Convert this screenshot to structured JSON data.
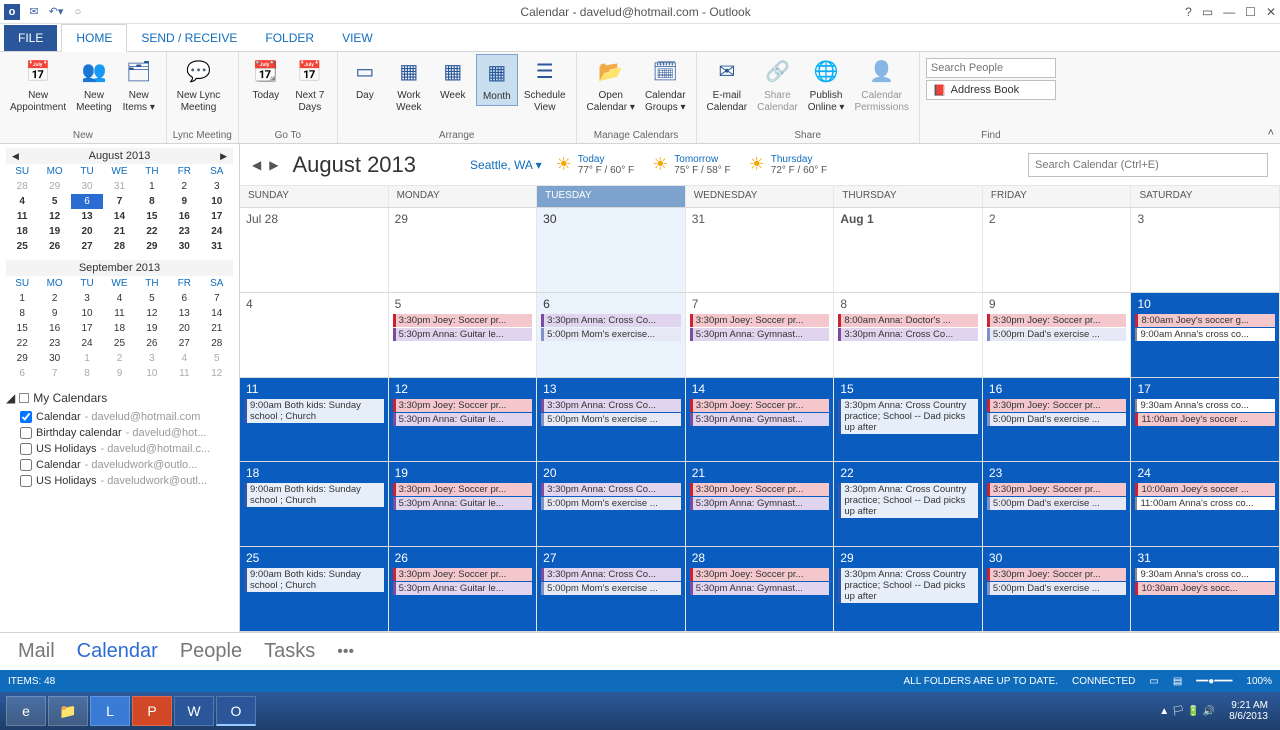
{
  "window": {
    "title": "Calendar - davelud@hotmail.com - Outlook"
  },
  "tabs": {
    "file": "FILE",
    "home": "HOME",
    "sendreceive": "SEND / RECEIVE",
    "folder": "FOLDER",
    "view": "VIEW"
  },
  "ribbon": {
    "new": {
      "label": "New",
      "appt": "New\nAppointment",
      "meeting": "New\nMeeting",
      "items": "New\nItems ▾"
    },
    "lync": {
      "label": "Lync Meeting",
      "btn": "New Lync\nMeeting"
    },
    "goto": {
      "label": "Go To",
      "today": "Today",
      "next7": "Next 7\nDays"
    },
    "arrange": {
      "label": "Arrange",
      "day": "Day",
      "workwk": "Work\nWeek",
      "week": "Week",
      "month": "Month",
      "sched": "Schedule\nView"
    },
    "manage": {
      "label": "Manage Calendars",
      "open": "Open\nCalendar ▾",
      "groups": "Calendar\nGroups ▾"
    },
    "share": {
      "label": "Share",
      "email": "E-mail\nCalendar",
      "share": "Share\nCalendar",
      "publish": "Publish\nOnline ▾",
      "perms": "Calendar\nPermissions"
    },
    "find": {
      "label": "Find",
      "search_placeholder": "Search People",
      "abook": "Address Book"
    }
  },
  "mini1": {
    "title": "August 2013",
    "dow": [
      "SU",
      "MO",
      "TU",
      "WE",
      "TH",
      "FR",
      "SA"
    ],
    "rows": [
      [
        "28",
        "29",
        "30",
        "31",
        "1",
        "2",
        "3"
      ],
      [
        "4",
        "5",
        "6",
        "7",
        "8",
        "9",
        "10"
      ],
      [
        "11",
        "12",
        "13",
        "14",
        "15",
        "16",
        "17"
      ],
      [
        "18",
        "19",
        "20",
        "21",
        "22",
        "23",
        "24"
      ],
      [
        "25",
        "26",
        "27",
        "28",
        "29",
        "30",
        "31"
      ]
    ]
  },
  "mini2": {
    "title": "September 2013",
    "dow": [
      "SU",
      "MO",
      "TU",
      "WE",
      "TH",
      "FR",
      "SA"
    ],
    "rows": [
      [
        "1",
        "2",
        "3",
        "4",
        "5",
        "6",
        "7"
      ],
      [
        "8",
        "9",
        "10",
        "11",
        "12",
        "13",
        "14"
      ],
      [
        "15",
        "16",
        "17",
        "18",
        "19",
        "20",
        "21"
      ],
      [
        "22",
        "23",
        "24",
        "25",
        "26",
        "27",
        "28"
      ],
      [
        "29",
        "30",
        "1",
        "2",
        "3",
        "4",
        "5"
      ],
      [
        "6",
        "7",
        "8",
        "9",
        "10",
        "11",
        "12"
      ]
    ]
  },
  "mycal": {
    "header": "My Calendars",
    "items": [
      {
        "checked": true,
        "name": "Calendar",
        "acct": "davelud@hotmail.com"
      },
      {
        "checked": false,
        "name": "Birthday calendar",
        "acct": "davelud@hot..."
      },
      {
        "checked": false,
        "name": "US Holidays",
        "acct": "davelud@hotmail.c..."
      },
      {
        "checked": false,
        "name": "Calendar",
        "acct": "daveludwork@outlo..."
      },
      {
        "checked": false,
        "name": "US Holidays",
        "acct": "daveludwork@outl..."
      }
    ]
  },
  "header": {
    "month": "August 2013",
    "location": "Seattle, WA  ▾",
    "wx": [
      {
        "lbl": "Today",
        "val": "77° F / 60° F"
      },
      {
        "lbl": "Tomorrow",
        "val": "75° F / 58° F"
      },
      {
        "lbl": "Thursday",
        "val": "72° F / 60° F"
      }
    ],
    "search_placeholder": "Search Calendar (Ctrl+E)"
  },
  "dow": [
    "SUNDAY",
    "MONDAY",
    "TUESDAY",
    "WEDNESDAY",
    "THURSDAY",
    "FRIDAY",
    "SATURDAY"
  ],
  "weeks": [
    [
      {
        "n": "Jul 28"
      },
      {
        "n": "29"
      },
      {
        "n": "30",
        "today": true
      },
      {
        "n": "31"
      },
      {
        "n": "Aug 1",
        "bold": true
      },
      {
        "n": "2"
      },
      {
        "n": "3"
      }
    ],
    [
      {
        "n": "4"
      },
      {
        "n": "5",
        "ev": [
          {
            "t": "3:30pm Joey: Soccer pr...",
            "c": "red"
          },
          {
            "t": "5:30pm Anna: Guitar le...",
            "c": "purple"
          }
        ]
      },
      {
        "n": "6",
        "today": true,
        "ev": [
          {
            "t": "3:30pm Anna: Cross Co...",
            "c": "purple"
          },
          {
            "t": "5:00pm Mom's exercise...",
            "c": "lav"
          }
        ]
      },
      {
        "n": "7",
        "ev": [
          {
            "t": "3:30pm Joey: Soccer pr...",
            "c": "red"
          },
          {
            "t": "5:30pm Anna: Gymnast...",
            "c": "purple"
          }
        ]
      },
      {
        "n": "8",
        "ev": [
          {
            "t": "8:00am Anna: Doctor's ...",
            "c": "red"
          },
          {
            "t": "3:30pm Anna: Cross Co...",
            "c": "purple"
          }
        ]
      },
      {
        "n": "9",
        "ev": [
          {
            "t": "3:30pm Joey: Soccer pr...",
            "c": "red"
          },
          {
            "t": "5:00pm Dad's exercise ...",
            "c": "lav"
          }
        ]
      },
      {
        "n": "10",
        "sel": true,
        "ev": [
          {
            "t": "8:00am Joey's soccer g...",
            "c": "red"
          },
          {
            "t": "9:00am Anna's cross co...",
            "c": "plain"
          }
        ]
      }
    ],
    [
      {
        "n": "11",
        "sel": true,
        "ev": [
          {
            "t": "9:00am Both kids: Sunday school ; Church",
            "c": "onblue",
            "wrap": true
          }
        ]
      },
      {
        "n": "12",
        "sel": true,
        "ev": [
          {
            "t": "3:30pm Joey: Soccer pr...",
            "c": "red"
          },
          {
            "t": "5:30pm Anna: Guitar le...",
            "c": "purple"
          }
        ]
      },
      {
        "n": "13",
        "sel": true,
        "ev": [
          {
            "t": "3:30pm Anna: Cross Co...",
            "c": "purple"
          },
          {
            "t": "5:00pm Mom's exercise ...",
            "c": "lav"
          }
        ]
      },
      {
        "n": "14",
        "sel": true,
        "ev": [
          {
            "t": "3:30pm Joey: Soccer pr...",
            "c": "red"
          },
          {
            "t": "5:30pm Anna: Gymnast...",
            "c": "purple"
          }
        ]
      },
      {
        "n": "15",
        "sel": true,
        "ev": [
          {
            "t": "3:30pm Anna: Cross Country practice; School -- Dad picks up after",
            "c": "onblue",
            "wrap": true
          }
        ]
      },
      {
        "n": "16",
        "sel": true,
        "ev": [
          {
            "t": "3:30pm Joey: Soccer pr...",
            "c": "red"
          },
          {
            "t": "5:00pm Dad's exercise ...",
            "c": "lav"
          }
        ]
      },
      {
        "n": "17",
        "sel": true,
        "ev": [
          {
            "t": "9:30am Anna's cross co...",
            "c": "plain"
          },
          {
            "t": "11:00am Joey's soccer ...",
            "c": "red"
          }
        ]
      }
    ],
    [
      {
        "n": "18",
        "sel": true,
        "ev": [
          {
            "t": "9:00am Both kids: Sunday school ; Church",
            "c": "onblue",
            "wrap": true
          }
        ]
      },
      {
        "n": "19",
        "sel": true,
        "ev": [
          {
            "t": "3:30pm Joey: Soccer pr...",
            "c": "red"
          },
          {
            "t": "5:30pm Anna: Guitar le...",
            "c": "purple"
          }
        ]
      },
      {
        "n": "20",
        "sel": true,
        "ev": [
          {
            "t": "3:30pm Anna: Cross Co...",
            "c": "purple"
          },
          {
            "t": "5:00pm Mom's exercise ...",
            "c": "lav"
          }
        ]
      },
      {
        "n": "21",
        "sel": true,
        "ev": [
          {
            "t": "3:30pm Joey: Soccer pr...",
            "c": "red"
          },
          {
            "t": "5:30pm Anna: Gymnast...",
            "c": "purple"
          }
        ]
      },
      {
        "n": "22",
        "sel": true,
        "ev": [
          {
            "t": "3:30pm Anna: Cross Country practice; School -- Dad picks up after",
            "c": "onblue",
            "wrap": true
          }
        ]
      },
      {
        "n": "23",
        "sel": true,
        "ev": [
          {
            "t": "3:30pm Joey: Soccer pr...",
            "c": "red"
          },
          {
            "t": "5:00pm Dad's exercise ...",
            "c": "lav"
          }
        ]
      },
      {
        "n": "24",
        "sel": true,
        "ev": [
          {
            "t": "10:00am Joey's soccer ...",
            "c": "red"
          },
          {
            "t": "11:00am Anna's cross co...",
            "c": "plain"
          }
        ]
      }
    ],
    [
      {
        "n": "25",
        "sel": true,
        "ev": [
          {
            "t": "9:00am Both kids: Sunday school ; Church",
            "c": "onblue",
            "wrap": true
          }
        ]
      },
      {
        "n": "26",
        "sel": true,
        "ev": [
          {
            "t": "3:30pm Joey: Soccer pr...",
            "c": "red"
          },
          {
            "t": "5:30pm Anna: Guitar le...",
            "c": "purple"
          }
        ]
      },
      {
        "n": "27",
        "sel": true,
        "ev": [
          {
            "t": "3:30pm Anna: Cross Co...",
            "c": "purple"
          },
          {
            "t": "5:00pm Mom's exercise ...",
            "c": "lav"
          }
        ]
      },
      {
        "n": "28",
        "sel": true,
        "ev": [
          {
            "t": "3:30pm Joey: Soccer pr...",
            "c": "red"
          },
          {
            "t": "5:30pm Anna: Gymnast...",
            "c": "purple"
          }
        ]
      },
      {
        "n": "29",
        "sel": true,
        "ev": [
          {
            "t": "3:30pm Anna: Cross Country practice; School -- Dad picks up after",
            "c": "onblue",
            "wrap": true
          }
        ]
      },
      {
        "n": "30",
        "sel": true,
        "ev": [
          {
            "t": "3:30pm Joey: Soccer pr...",
            "c": "red"
          },
          {
            "t": "5:00pm Dad's exercise ...",
            "c": "lav"
          }
        ]
      },
      {
        "n": "31",
        "sel": true,
        "ev": [
          {
            "t": "9:30am Anna's cross co...",
            "c": "plain"
          },
          {
            "t": "10:30am Joey's socc...",
            "c": "red"
          }
        ]
      }
    ]
  ],
  "nav": {
    "mail": "Mail",
    "cal": "Calendar",
    "people": "People",
    "tasks": "Tasks"
  },
  "status": {
    "items": "ITEMS: 48",
    "folders": "ALL FOLDERS ARE UP TO DATE.",
    "conn": "CONNECTED",
    "zoom": "100%"
  },
  "taskbar": {
    "time": "9:21 AM",
    "date": "8/6/2013"
  }
}
